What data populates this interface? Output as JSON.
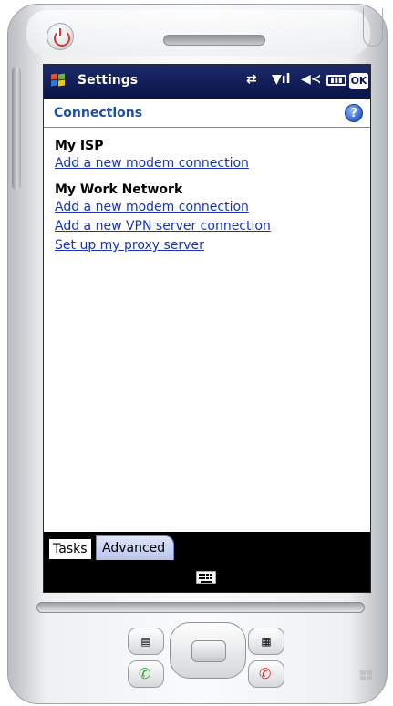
{
  "titlebar": {
    "app_title": "Settings",
    "status_icons": [
      "connectivity-icon",
      "signal-strength-icon",
      "volume-icon",
      "battery-icon"
    ],
    "ok_label": "OK"
  },
  "subheader": {
    "title": "Connections",
    "help_icon": "?"
  },
  "sections": [
    {
      "heading": "My ISP",
      "links": [
        "Add a new modem connection"
      ]
    },
    {
      "heading": "My Work Network",
      "links": [
        "Add a new modem connection",
        "Add a new VPN server connection",
        "Set up my proxy server"
      ]
    }
  ],
  "tabs": {
    "tasks": "Tasks",
    "advanced": "Advanced"
  },
  "colors": {
    "titlebar": "#0b1448",
    "subheader_title": "#1f4ea3",
    "link": "#1833b8",
    "tab_active": "#b9c4ee",
    "power": "#d23a32",
    "call_green": "#2fa336",
    "call_red": "#d02a22"
  }
}
